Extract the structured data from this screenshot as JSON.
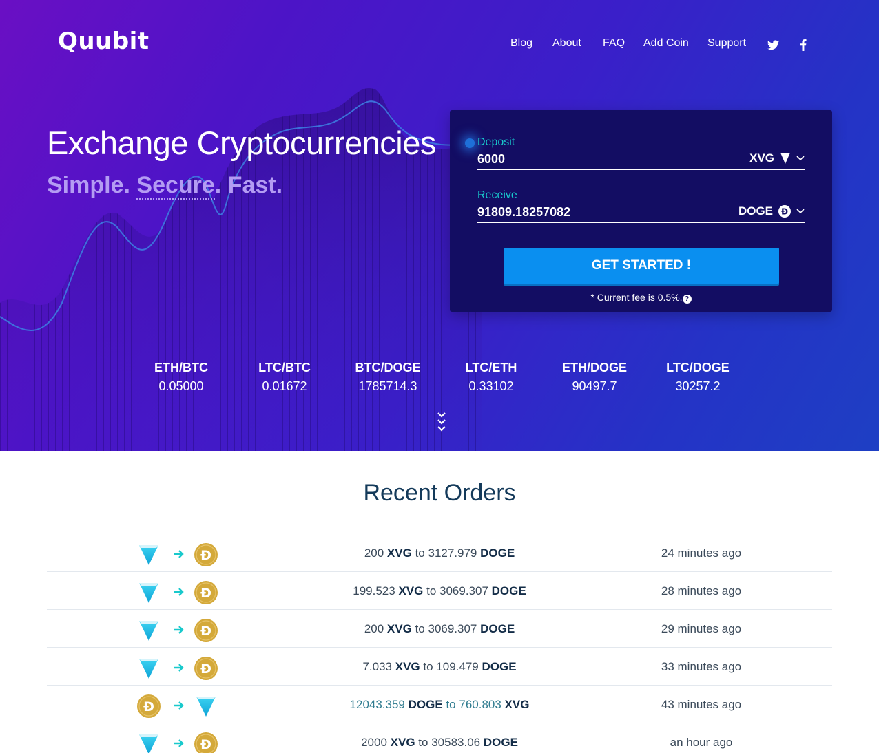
{
  "brand": {
    "logo": "Quubit"
  },
  "nav": {
    "items": [
      "Blog",
      "About",
      "FAQ",
      "Add Coin",
      "Support"
    ],
    "icons": [
      "twitter-icon",
      "facebook-icon"
    ]
  },
  "hero": {
    "headline": "Exchange Cryptocurrencies",
    "tagline_simple": "Simple.",
    "tagline_secure": "Secure",
    "tagline_dot": ".",
    "tagline_fast": "Fast."
  },
  "exchange": {
    "deposit_label": "Deposit",
    "deposit_value": "6000",
    "deposit_coin": "XVG",
    "receive_label": "Receive",
    "receive_value": "91809.18257082",
    "receive_coin": "DOGE",
    "cta_label": "GET STARTED !",
    "fee_text": "* Current fee is 0.5%.",
    "fee_help": "?"
  },
  "tickers": [
    {
      "pair": "ETH/BTC",
      "rate": "0.05000"
    },
    {
      "pair": "LTC/BTC",
      "rate": "0.01672"
    },
    {
      "pair": "BTC/DOGE",
      "rate": "1785714.3"
    },
    {
      "pair": "LTC/ETH",
      "rate": "0.33102"
    },
    {
      "pair": "ETH/DOGE",
      "rate": "90497.7"
    },
    {
      "pair": "LTC/DOGE",
      "rate": "30257.2"
    }
  ],
  "recent_orders": {
    "title": "Recent Orders",
    "rows": [
      {
        "from_amount": "200",
        "from_coin": "XVG",
        "connector": "to",
        "to_amount": "3127.979",
        "to_coin": "DOGE",
        "time": "24 minutes ago"
      },
      {
        "from_amount": "199.523",
        "from_coin": "XVG",
        "connector": "to",
        "to_amount": "3069.307",
        "to_coin": "DOGE",
        "time": "28 minutes ago"
      },
      {
        "from_amount": "200",
        "from_coin": "XVG",
        "connector": "to",
        "to_amount": "3069.307",
        "to_coin": "DOGE",
        "time": "29 minutes ago"
      },
      {
        "from_amount": "7.033",
        "from_coin": "XVG",
        "connector": "to",
        "to_amount": "109.479",
        "to_coin": "DOGE",
        "time": "33 minutes ago"
      },
      {
        "from_amount": "12043.359",
        "from_coin": "DOGE",
        "connector": "to",
        "to_amount": "760.803",
        "to_coin": "XVG",
        "time": "43 minutes ago"
      },
      {
        "from_amount": "2000",
        "from_coin": "XVG",
        "connector": "to",
        "to_amount": "30583.06",
        "to_coin": "DOGE",
        "time": "an hour ago"
      }
    ]
  },
  "colors": {
    "accent": "#19c9cc",
    "button": "#0a8ff0",
    "card": "#130d63",
    "doge": "#d4a93a",
    "xvg": "#1fb6e0",
    "heading": "#143a5a"
  }
}
